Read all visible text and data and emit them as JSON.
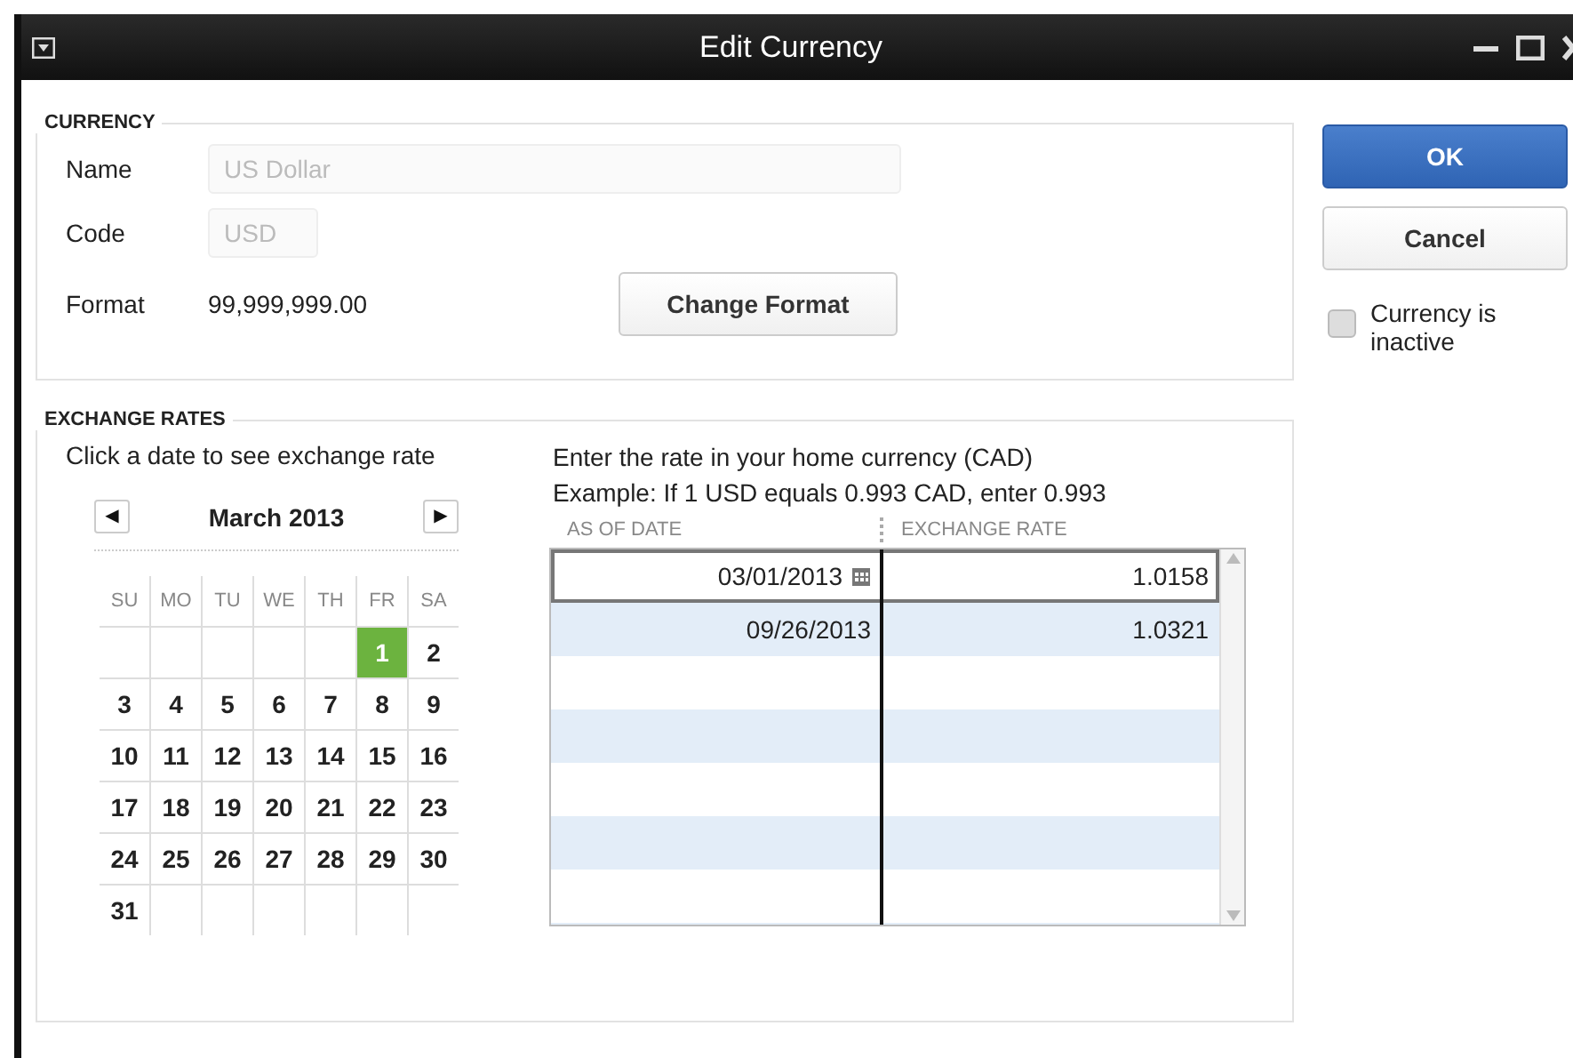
{
  "window": {
    "title": "Edit Currency"
  },
  "currency": {
    "legend": "CURRENCY",
    "name": {
      "label": "Name",
      "value": "US Dollar",
      "disabled": true
    },
    "code": {
      "label": "Code",
      "value": "USD",
      "disabled": true
    },
    "format": {
      "label": "Format",
      "value": "99,999,999.00"
    },
    "change_format_button": "Change Format"
  },
  "exchange_rates": {
    "legend": "EXCHANGE RATES",
    "calendar": {
      "hint": "Click a date to see exchange rate",
      "month": "March 2013",
      "prev": "◀",
      "next": "▶",
      "weekdays": [
        "SU",
        "MO",
        "TU",
        "WE",
        "TH",
        "FR",
        "SA"
      ],
      "weeks": [
        {
          "kind": "first",
          "days": [
            {
              "day": "1",
              "selected": true
            },
            {
              "day": "2",
              "selected": false
            }
          ]
        },
        {
          "kind": "full",
          "days": [
            {
              "day": "3",
              "selected": false
            },
            {
              "day": "4",
              "selected": false
            },
            {
              "day": "5",
              "selected": false
            },
            {
              "day": "6",
              "selected": false
            },
            {
              "day": "7",
              "selected": false
            },
            {
              "day": "8",
              "selected": false
            },
            {
              "day": "9",
              "selected": false
            }
          ]
        },
        {
          "kind": "full",
          "days": [
            {
              "day": "10",
              "selected": false
            },
            {
              "day": "11",
              "selected": false
            },
            {
              "day": "12",
              "selected": false
            },
            {
              "day": "13",
              "selected": false
            },
            {
              "day": "14",
              "selected": false
            },
            {
              "day": "15",
              "selected": false
            },
            {
              "day": "16",
              "selected": false
            }
          ]
        },
        {
          "kind": "full",
          "days": [
            {
              "day": "17",
              "selected": false
            },
            {
              "day": "18",
              "selected": false
            },
            {
              "day": "19",
              "selected": false
            },
            {
              "day": "20",
              "selected": false
            },
            {
              "day": "21",
              "selected": false
            },
            {
              "day": "22",
              "selected": false
            },
            {
              "day": "23",
              "selected": false
            }
          ]
        },
        {
          "kind": "full",
          "days": [
            {
              "day": "24",
              "selected": false
            },
            {
              "day": "25",
              "selected": false
            },
            {
              "day": "26",
              "selected": false
            },
            {
              "day": "27",
              "selected": false
            },
            {
              "day": "28",
              "selected": false
            },
            {
              "day": "29",
              "selected": false
            },
            {
              "day": "30",
              "selected": false
            }
          ]
        },
        {
          "kind": "last",
          "days": [
            {
              "day": "31",
              "selected": false
            }
          ]
        }
      ]
    },
    "instructions": [
      "Enter the rate in your home currency (CAD)",
      "Example: If 1 USD equals 0.993 CAD, enter 0.993"
    ],
    "table": {
      "columns": [
        "AS OF DATE",
        "EXCHANGE RATE"
      ],
      "rows": [
        {
          "as_of_date": "03/01/2013",
          "exchange_rate": "1.0158",
          "selected": true
        },
        {
          "as_of_date": "09/26/2013",
          "exchange_rate": "1.0321",
          "selected": false
        }
      ]
    }
  },
  "buttons": [
    {
      "label": "OK",
      "kind": "primary"
    },
    {
      "label": "Cancel",
      "kind": "secondary"
    }
  ],
  "currency_inactive": {
    "label": "Currency is inactive",
    "checked": false
  }
}
